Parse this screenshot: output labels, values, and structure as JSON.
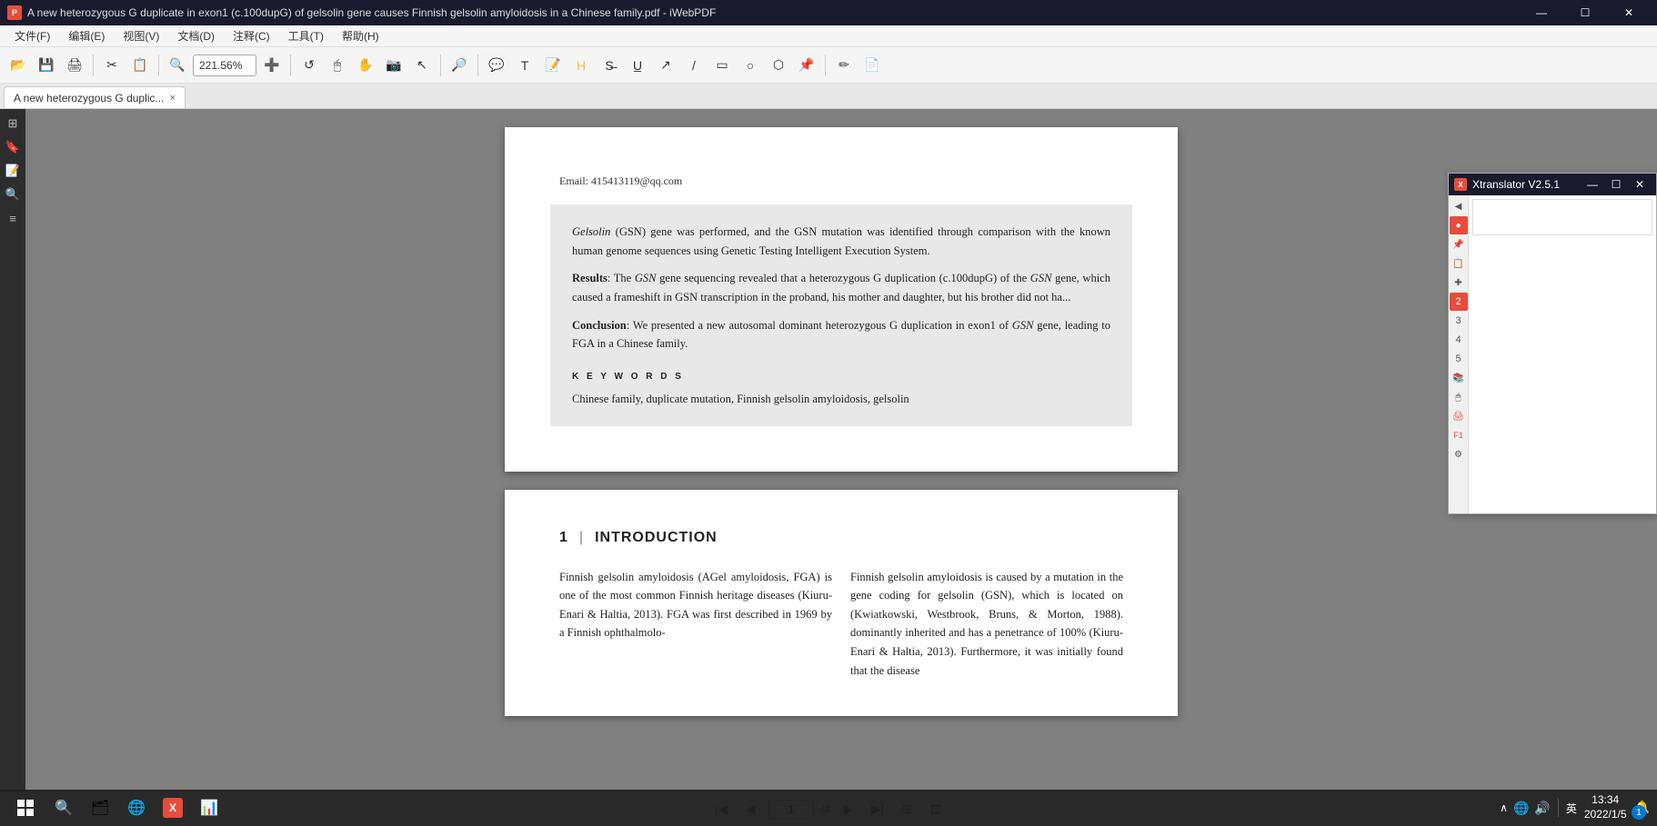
{
  "titlebar": {
    "title": "A new heterozygous G duplicate in exon1 (c.100dupG) of gelsolin gene causes Finnish gelsolin amyloidosis in a Chinese family.pdf - iWebPDF",
    "icon_label": "P",
    "controls": [
      "—",
      "☐",
      "✕"
    ]
  },
  "menubar": {
    "items": [
      "文件(F)",
      "编辑(E)",
      "视图(V)",
      "文档(D)",
      "注释(C)",
      "工具(T)",
      "帮助(H)"
    ]
  },
  "toolbar": {
    "zoom_value": "221.56%",
    "buttons": [
      "📁",
      "💾",
      "🖨",
      "✂",
      "📋",
      "⬅",
      "➡",
      "🔍",
      "🔎",
      "👆",
      "🗂",
      "🖱",
      "✏",
      "📌",
      "📐"
    ]
  },
  "tab": {
    "label": "A new heterozygous G duplic...",
    "close": "×"
  },
  "pdf": {
    "email": "Email: 415413119@qq.com",
    "abstract_paragraphs": [
      {
        "label": "",
        "text": "Gelsolin (GSN) gene was performed, and the GSN mutation was identified through comparison with the known human genome sequences using Genetic Testing Intelligent Execution System."
      },
      {
        "label": "Results",
        "text": ": The GSN gene sequencing revealed that a heterozygous G duplication (c.100dupG) of the GSN gene, which caused a frameshift in GSN transcription in the proband, his mother and daughter, but his brother did not ha..."
      },
      {
        "label": "Conclusion",
        "text": ": We presented a new autosomal dominant heterozygous G duplication in exon1 of GSN gene, leading to FGA in a Chinese family."
      }
    ],
    "keywords_title": "K E Y W O R D S",
    "keywords": "Chinese family, duplicate mutation, Finnish gelsolin amyloidosis, gelsolin",
    "section1_number": "1",
    "section1_pipe": "|",
    "section1_title": "INTRODUCTION",
    "intro_left": "Finnish gelsolin amyloidosis (AGel amyloidosis, FGA) is one of the most common Finnish heritage diseases (Kiuru-Enari & Haltia, 2013). FGA was first described in 1969 by a Finnish ophthalmolo-",
    "intro_right": "Finnish gelsolin amyloidosis is caused by a mutation in the gene coding for gelsolin (GSN), which is located on (Kwiatkowski, Westbrook, Bruns, & Morton, 1988). dominantly inherited and has a penetrance of 100% (Kiuru-Enari & Haltia, 2013). Furthermore, it was initially found that the disease"
  },
  "navigation": {
    "current_page": "1/4",
    "page_input": "1",
    "total": "4"
  },
  "xtranslator": {
    "title": "Xtranslator V2.5.1",
    "icon_label": "X",
    "controls": [
      "—",
      "☐",
      "✕"
    ],
    "sidebar_buttons": [
      "🔒",
      "❤",
      "📌",
      "📋",
      "✚",
      "①",
      "②",
      "③",
      "④",
      "⑤",
      "🖱",
      "🖨",
      "🔴",
      "⚙"
    ],
    "input_placeholder": ""
  },
  "taskbar": {
    "start_icon": "⊞",
    "search_icon": "🔍",
    "task_apps": [
      {
        "icon": "🗂",
        "color": "#ffb900",
        "label": "file-explorer"
      },
      {
        "icon": "🌐",
        "color": "#0078d4",
        "label": "edge"
      },
      {
        "icon": "📧",
        "color": "#0078d4",
        "label": "mail"
      },
      {
        "icon": "🟥",
        "color": "#e74c3c",
        "label": "pdf-app"
      },
      {
        "icon": "📊",
        "color": "#d83b01",
        "label": "powerpoint"
      }
    ],
    "systray": {
      "lang": "英",
      "notification_label": "1个新通知",
      "time": "13:34",
      "date": "2022/1/5"
    }
  }
}
